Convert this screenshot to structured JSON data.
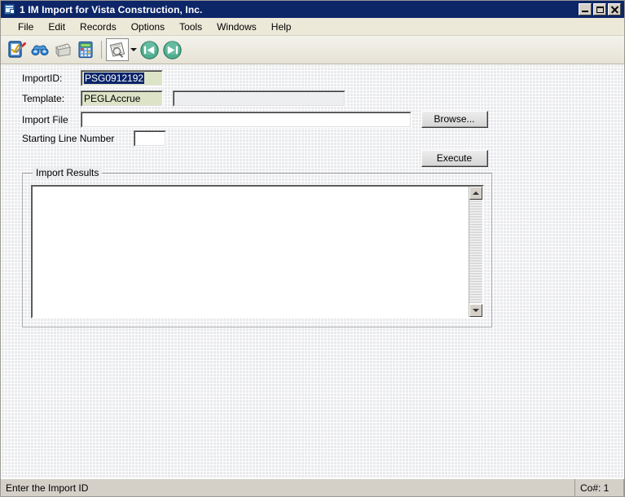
{
  "window": {
    "title": "1 IM Import for Vista Construction, Inc.",
    "icon": "window-document-icon",
    "titlebar_color": "#0d2668",
    "minimize_label": "_",
    "maximize_label": "□",
    "close_label": "×"
  },
  "menubar": {
    "items": [
      {
        "label": "File"
      },
      {
        "label": "Edit"
      },
      {
        "label": "Records"
      },
      {
        "label": "Options"
      },
      {
        "label": "Tools"
      },
      {
        "label": "Windows"
      },
      {
        "label": "Help"
      }
    ]
  },
  "toolbar": {
    "buttons": [
      {
        "icon": "form-edit-icon",
        "pressed": false
      },
      {
        "icon": "binoculars-icon",
        "pressed": false
      },
      {
        "icon": "stamp-icon",
        "pressed": false
      },
      {
        "icon": "calculator-icon",
        "pressed": false
      },
      {
        "icon": "document-search-icon",
        "pressed": true
      },
      {
        "icon": "chevron-down-icon",
        "pressed": false
      },
      {
        "icon": "green-first-record-icon",
        "pressed": false
      },
      {
        "icon": "green-last-record-icon",
        "pressed": false
      }
    ]
  },
  "form": {
    "import_id": {
      "label": "ImportID:",
      "value": "PSG0912192",
      "selected": true,
      "field_color": "#dde3c6",
      "selection_color": "#0a246a"
    },
    "template": {
      "label": "Template:",
      "value": "PEGLAccrue",
      "field_color": "#dde3c6"
    },
    "template_description": {
      "value": "",
      "placeholder": ""
    },
    "import_file": {
      "label": "Import File",
      "value": "",
      "placeholder": ""
    },
    "browse_button": {
      "label": "Browse..."
    },
    "starting_line_number": {
      "label": "Starting Line Number",
      "value": "",
      "placeholder": ""
    },
    "execute_button": {
      "label": "Execute"
    }
  },
  "import_results": {
    "title": "Import Results",
    "content": "",
    "scrollbar": {
      "up_arrow": "scroll-up-icon",
      "down_arrow": "scroll-down-icon"
    }
  },
  "statusbar": {
    "message": "Enter the Import ID",
    "company": "Co#: 1"
  }
}
